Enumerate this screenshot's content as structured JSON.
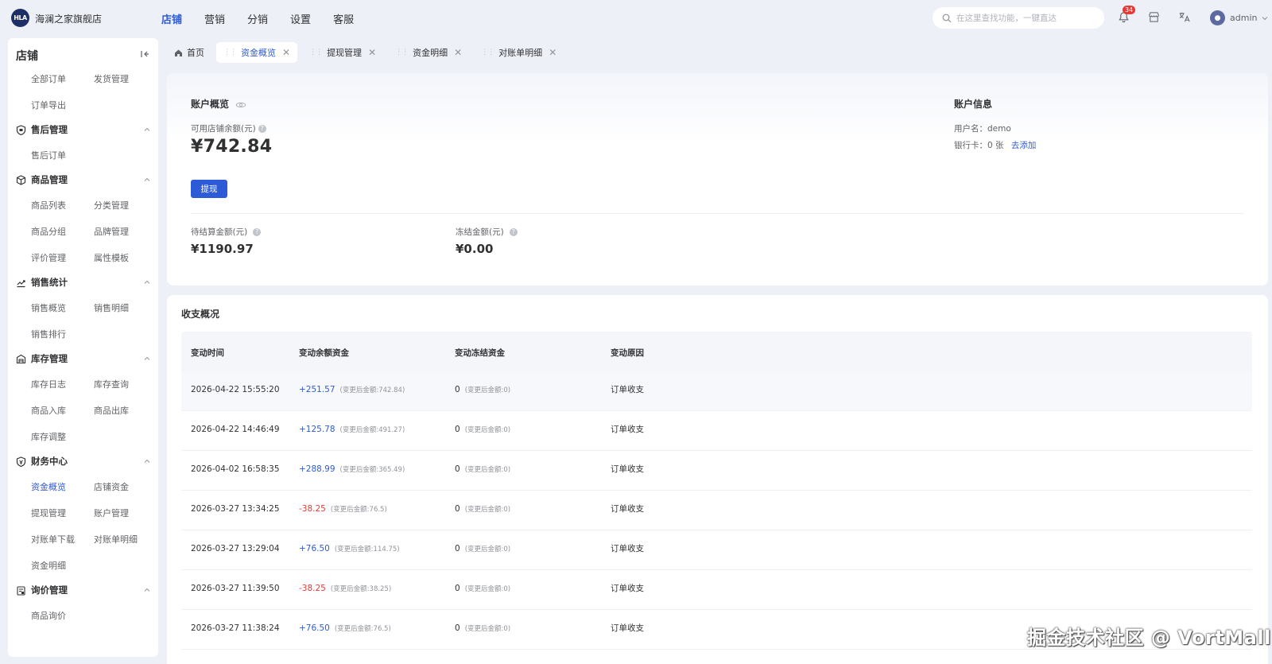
{
  "topbar": {
    "logo_text": "HLA",
    "shop_name": "海澜之家旗舰店",
    "nav": [
      "店铺",
      "营销",
      "分销",
      "设置",
      "客服"
    ],
    "active_nav": "店铺",
    "search_placeholder": "在这里查找功能，一键直达",
    "notification_count": "34",
    "username": "admin"
  },
  "sidebar": {
    "title": "店铺",
    "top_items": [
      "全部订单",
      "发货管理",
      "订单导出"
    ],
    "groups": [
      {
        "label": "售后管理",
        "icon": "shield-icon",
        "items": [
          "售后订单"
        ]
      },
      {
        "label": "商品管理",
        "icon": "box-icon",
        "items": [
          "商品列表",
          "分类管理",
          "商品分组",
          "品牌管理",
          "评价管理",
          "属性模板"
        ]
      },
      {
        "label": "销售统计",
        "icon": "chart-icon",
        "items": [
          "销售概览",
          "销售明细",
          "销售排行"
        ]
      },
      {
        "label": "库存管理",
        "icon": "warehouse-icon",
        "items": [
          "库存日志",
          "库存查询",
          "商品入库",
          "商品出库",
          "库存调整"
        ]
      },
      {
        "label": "财务中心",
        "icon": "finance-icon",
        "items": [
          "资金概览",
          "店铺资金",
          "提现管理",
          "账户管理",
          "对账单下载",
          "对账单明细",
          "资金明细"
        ]
      },
      {
        "label": "询价管理",
        "icon": "inquiry-icon",
        "items": [
          "商品询价"
        ]
      }
    ],
    "active_item": "资金概览"
  },
  "tabs": [
    {
      "label": "首页",
      "closable": false
    },
    {
      "label": "资金概览",
      "closable": true,
      "active": true
    },
    {
      "label": "提现管理",
      "closable": true
    },
    {
      "label": "资金明细",
      "closable": true
    },
    {
      "label": "对账单明细",
      "closable": true
    }
  ],
  "overview": {
    "title": "账户概览",
    "balance_label": "可用店铺余额(元)",
    "balance": "¥742.84",
    "withdraw_button": "提现",
    "pending_label": "待结算金额(元)",
    "pending": "¥1190.97",
    "frozen_label": "冻结金额(元)",
    "frozen": "¥0.00"
  },
  "account_info": {
    "title": "账户信息",
    "username_label": "用户名：",
    "username": "demo",
    "bank_label": "银行卡：",
    "bank_count": "0 张",
    "add_link": "去添加"
  },
  "ledger": {
    "title": "收支概况",
    "columns": [
      "变动时间",
      "变动余额资金",
      "变动冻结资金",
      "变动原因"
    ],
    "rows": [
      {
        "time": "2026-04-22 15:55:20",
        "change": "+251.57",
        "after": "(变更后金额:742.84)",
        "frozen": "0",
        "frozen_after": "(变更后金额:0)",
        "reason": "订单收支"
      },
      {
        "time": "2026-04-22 14:46:49",
        "change": "+125.78",
        "after": "(变更后金额:491.27)",
        "frozen": "0",
        "frozen_after": "(变更后金额:0)",
        "reason": "订单收支"
      },
      {
        "time": "2026-04-02 16:58:35",
        "change": "+288.99",
        "after": "(变更后金额:365.49)",
        "frozen": "0",
        "frozen_after": "(变更后金额:0)",
        "reason": "订单收支"
      },
      {
        "time": "2026-03-27 13:34:25",
        "change": "-38.25",
        "after": "(变更后金额:76.5)",
        "frozen": "0",
        "frozen_after": "(变更后金额:0)",
        "reason": "订单收支"
      },
      {
        "time": "2026-03-27 13:29:04",
        "change": "+76.50",
        "after": "(变更后金额:114.75)",
        "frozen": "0",
        "frozen_after": "(变更后金额:0)",
        "reason": "订单收支"
      },
      {
        "time": "2026-03-27 11:39:50",
        "change": "-38.25",
        "after": "(变更后金额:38.25)",
        "frozen": "0",
        "frozen_after": "(变更后金额:0)",
        "reason": "订单收支"
      },
      {
        "time": "2026-03-27 11:38:24",
        "change": "+76.50",
        "after": "(变更后金额:76.5)",
        "frozen": "0",
        "frozen_after": "(变更后金额:0)",
        "reason": "订单收支"
      }
    ]
  },
  "watermark": "掘金技术社区 @ VortMall",
  "colors": {
    "accent": "#2d5bd8",
    "negative": "#e53935",
    "badge": "#e53935",
    "background": "#eef0f8"
  }
}
